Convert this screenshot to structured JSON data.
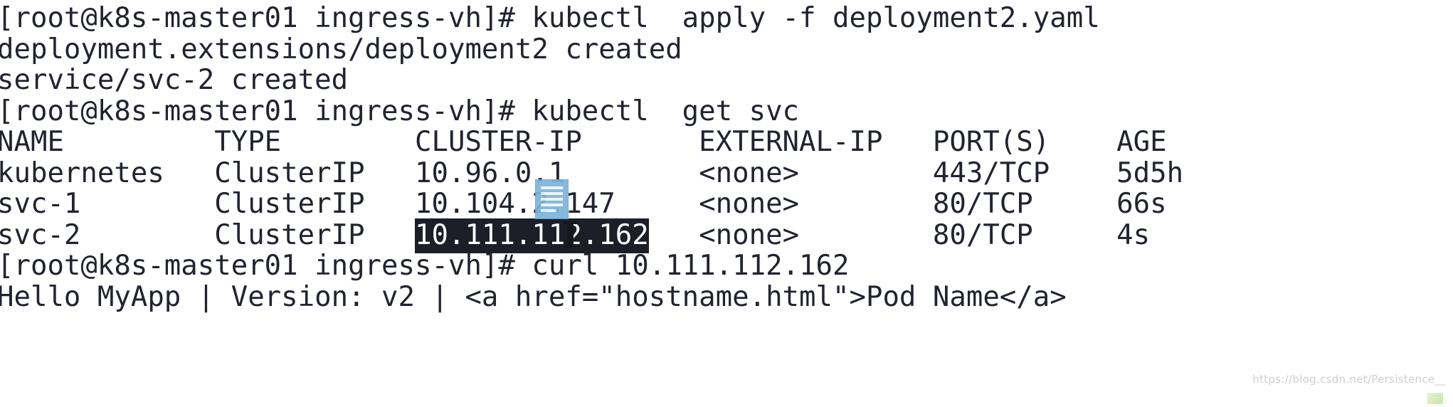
{
  "terminal": {
    "shell_prompt": "[root@k8s-master01 ingress-vh]#",
    "hostname": "k8s-master01",
    "user": "root",
    "cwd": "ingress-vh",
    "foreground_color": "#21242f",
    "background_color": "#ffffff",
    "selection_background": "#1c1f27",
    "selection_foreground": "#ffffff",
    "lines": [
      {
        "id": "cmd-apply",
        "type": "command",
        "text": "[root@k8s-master01 ingress-vh]# kubectl  apply -f deployment2.yaml"
      },
      {
        "id": "out-deployment-created",
        "type": "output",
        "text": "deployment.extensions/deployment2 created"
      },
      {
        "id": "out-service-created",
        "type": "output",
        "text": "service/svc-2 created"
      },
      {
        "id": "cmd-get-svc",
        "type": "command",
        "text": "[root@k8s-master01 ingress-vh]# kubectl  get svc"
      },
      {
        "id": "table-header",
        "type": "table-header",
        "text": "NAME         TYPE        CLUSTER-IP       EXTERNAL-IP   PORT(S)    AGE"
      },
      {
        "id": "row-kubernetes",
        "type": "table-row",
        "text": "kubernetes   ClusterIP   10.96.0.1        <none>        443/TCP    5d5h"
      },
      {
        "id": "row-svc-1",
        "type": "table-row",
        "text": "svc-1        ClusterIP   10.104.2.147     <none>        80/TCP     66s"
      },
      {
        "id": "row-svc-2",
        "type": "table-row-selected",
        "prefix": "svc-2        ClusterIP   ",
        "selected": "10.111.112.162",
        "suffix": "   <none>        80/TCP     4s"
      },
      {
        "id": "cmd-curl",
        "type": "command",
        "text": "[root@k8s-master01 ingress-vh]# curl 10.111.112.162"
      },
      {
        "id": "out-curl-response",
        "type": "output",
        "text": "Hello MyApp | Version: v2 | <a href=\"hostname.html\">Pod Name</a>"
      }
    ],
    "commands": {
      "apply": "kubectl  apply -f deployment2.yaml",
      "get_svc": "kubectl  get svc",
      "curl": "curl 10.111.112.162"
    },
    "manifest_file": "deployment2.yaml",
    "service_table": {
      "columns": [
        "NAME",
        "TYPE",
        "CLUSTER-IP",
        "EXTERNAL-IP",
        "PORT(S)",
        "AGE"
      ],
      "rows": [
        {
          "name": "kubernetes",
          "type": "ClusterIP",
          "cluster_ip": "10.96.0.1",
          "external_ip": "<none>",
          "ports": "443/TCP",
          "age": "5d5h",
          "selected": false
        },
        {
          "name": "svc-1",
          "type": "ClusterIP",
          "cluster_ip": "10.104.2.147",
          "external_ip": "<none>",
          "ports": "80/TCP",
          "age": "66s",
          "selected": false
        },
        {
          "name": "svc-2",
          "type": "ClusterIP",
          "cluster_ip": "10.111.112.162",
          "external_ip": "<none>",
          "ports": "80/TCP",
          "age": "4s",
          "selected": true
        }
      ]
    },
    "curl_response": "Hello MyApp | Version: v2 | <a href=\"hostname.html\">Pod Name</a>",
    "selected_text": "10.111.112.162"
  },
  "cursor": {
    "kind": "text-select-document-cursor",
    "color": "#7fb4db",
    "line_color": "#eaf3fa",
    "caret_color": "#15181f"
  },
  "watermark": {
    "text": "https://blog.csdn.net/Persistence__"
  }
}
